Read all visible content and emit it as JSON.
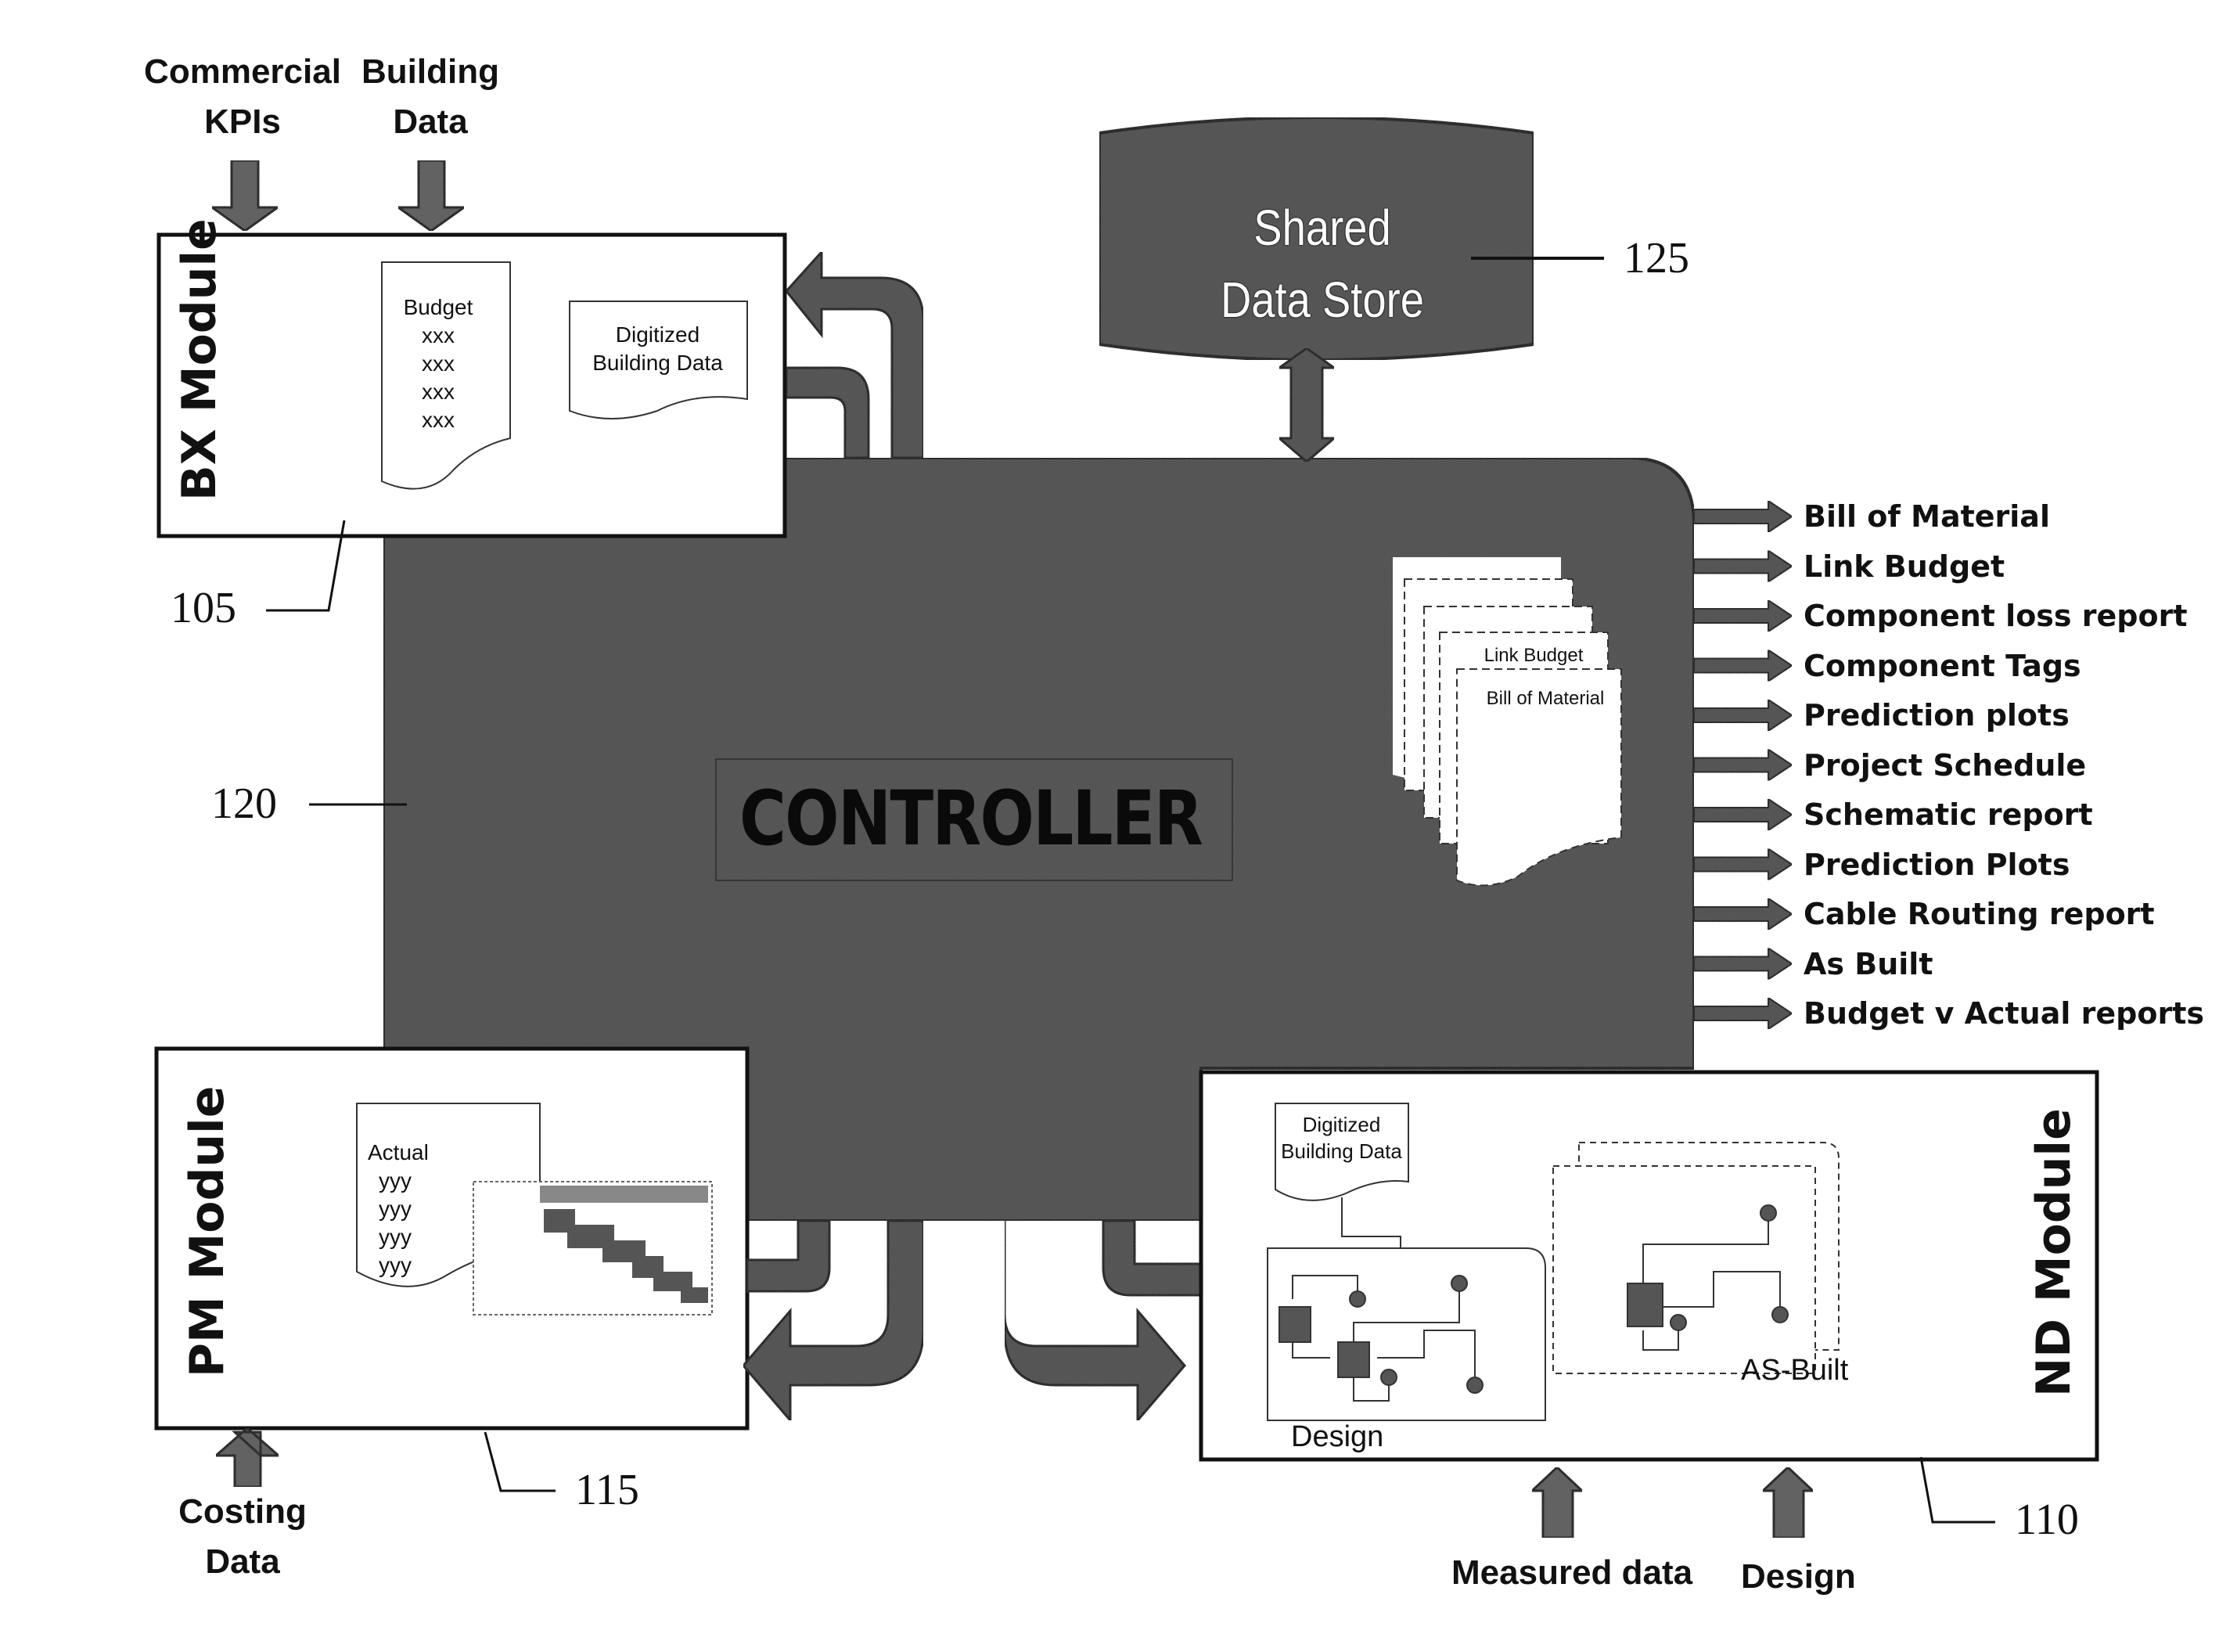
{
  "inputs": {
    "commercial_kpis": "Commercial\nKPIs",
    "building_data": "Building\nData",
    "costing_data": "Costing\nData",
    "measured_data": "Measured data",
    "design": "Design"
  },
  "shared_store": {
    "line1": "Shared",
    "line2": "Data Store",
    "ref": "125"
  },
  "controller": {
    "label": "CONTROLLER",
    "ref": "120"
  },
  "bx_module": {
    "title": "BX Module",
    "ref": "105",
    "budget_doc": {
      "title": "Budget",
      "rows": [
        "xxx",
        "xxx",
        "xxx",
        "xxx"
      ]
    },
    "digitized_doc": {
      "line1": "Digitized",
      "line2": "Building Data"
    }
  },
  "pm_module": {
    "title": "PM Module",
    "ref": "115",
    "actual_doc": {
      "title": "Actual",
      "rows": [
        "yyy",
        "yyy",
        "yyy",
        "yyy"
      ]
    }
  },
  "nd_module": {
    "title": "ND Module",
    "ref": "110",
    "digitized_doc": {
      "line1": "Digitized",
      "line2": "Building Data"
    },
    "design_caption": "Design",
    "asbuilt_caption": "AS-Built"
  },
  "report_stack": {
    "front": "Bill of Material",
    "second": "Link Budget"
  },
  "outputs": [
    "Bill of Material",
    "Link Budget",
    "Component loss report",
    "Component  Tags",
    "Prediction plots",
    "Project Schedule",
    "Schematic report",
    "Prediction Plots",
    "Cable Routing report",
    "As Built",
    "Budget v Actual reports"
  ],
  "colors": {
    "fill_dark": "#4a4a4a",
    "fill_mid": "#6a6a6a",
    "ink": "#111111",
    "paper": "#ffffff"
  }
}
